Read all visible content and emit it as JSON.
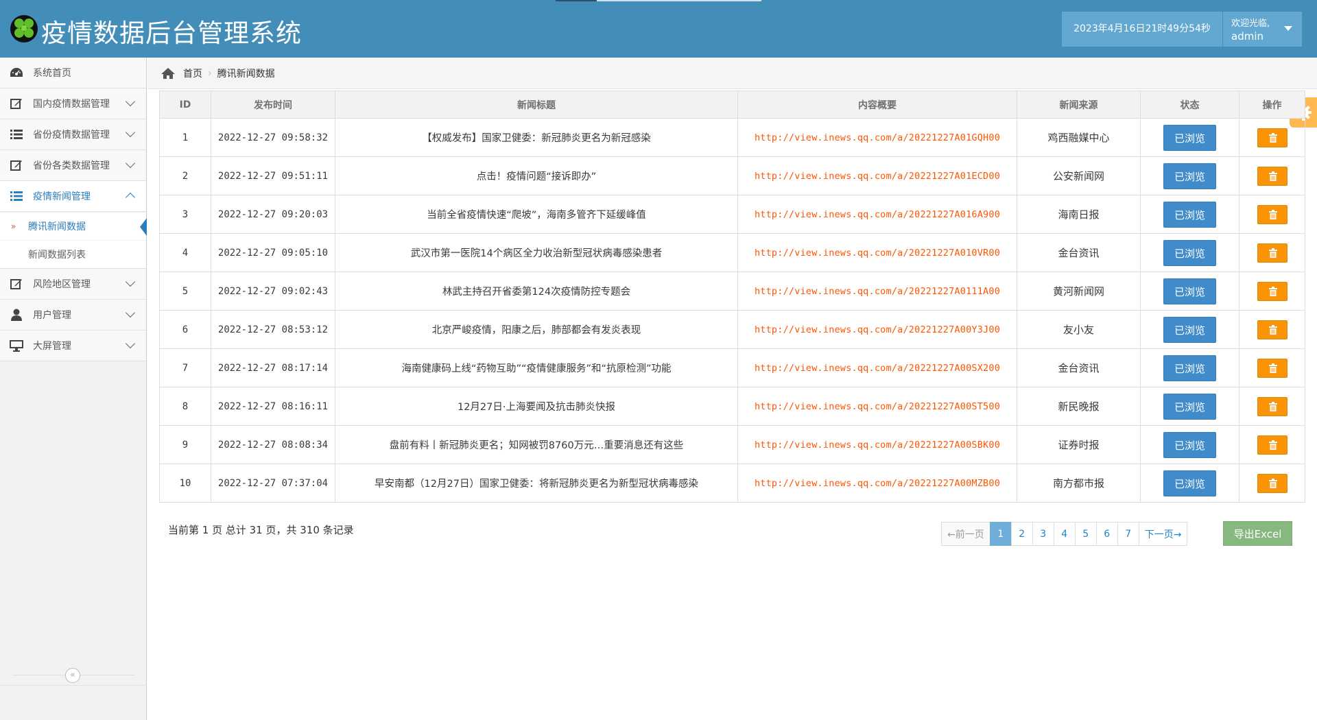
{
  "app": {
    "title": "疫情数据后台管理系统",
    "datetime": "2023年4月16日21时49分54秒",
    "welcome": "欢迎光临,",
    "username": "admin"
  },
  "sidebar": {
    "items": [
      {
        "label": "系统首页",
        "icon": "dashboard-icon"
      },
      {
        "label": "国内疫情数据管理",
        "icon": "edit-icon"
      },
      {
        "label": "省份疫情数据管理",
        "icon": "list-icon"
      },
      {
        "label": "省份各类数据管理",
        "icon": "edit-icon"
      },
      {
        "label": "疫情新闻管理",
        "icon": "list-icon"
      },
      {
        "label": "风险地区管理",
        "icon": "edit-icon"
      },
      {
        "label": "用户管理",
        "icon": "user-icon"
      },
      {
        "label": "大屏管理",
        "icon": "desktop-icon"
      }
    ],
    "submenu": [
      {
        "label": "腾讯新闻数据"
      },
      {
        "label": "新闻数据列表"
      }
    ],
    "collapse_glyph": "«"
  },
  "breadcrumb": {
    "home": "首页",
    "sep": "›",
    "current": "腾讯新闻数据"
  },
  "table": {
    "columns": [
      "ID",
      "发布时间",
      "新闻标题",
      "内容概要",
      "新闻来源",
      "状态",
      "操作"
    ],
    "rows": [
      {
        "id": "1",
        "time": "2022-12-27 09:58:32",
        "title": "【权威发布】国家卫健委：新冠肺炎更名为新冠感染",
        "url": "http://view.inews.qq.com/a/20221227A01GQH00",
        "source": "鸡西融媒中心",
        "status": "已浏览"
      },
      {
        "id": "2",
        "time": "2022-12-27 09:51:11",
        "title": "点击！疫情问题“接诉即办”",
        "url": "http://view.inews.qq.com/a/20221227A01ECD00",
        "source": "公安新闻网",
        "status": "已浏览"
      },
      {
        "id": "3",
        "time": "2022-12-27 09:20:03",
        "title": "当前全省疫情快速“爬坡”，海南多管齐下延缓峰值",
        "url": "http://view.inews.qq.com/a/20221227A016A900",
        "source": "海南日报",
        "status": "已浏览"
      },
      {
        "id": "4",
        "time": "2022-12-27 09:05:10",
        "title": "武汉市第一医院14个病区全力收治新型冠状病毒感染患者",
        "url": "http://view.inews.qq.com/a/20221227A010VR00",
        "source": "金台资讯",
        "status": "已浏览"
      },
      {
        "id": "5",
        "time": "2022-12-27 09:02:43",
        "title": "林武主持召开省委第124次疫情防控专题会",
        "url": "http://view.inews.qq.com/a/20221227A0111A00",
        "source": "黄河新闻网",
        "status": "已浏览"
      },
      {
        "id": "6",
        "time": "2022-12-27 08:53:12",
        "title": "北京严峻疫情，阳康之后，肺部都会有发炎表现",
        "url": "http://view.inews.qq.com/a/20221227A00Y3J00",
        "source": "友小友",
        "status": "已浏览"
      },
      {
        "id": "7",
        "time": "2022-12-27 08:17:14",
        "title": "海南健康码上线“药物互助”“疫情健康服务”和“抗原检测”功能",
        "url": "http://view.inews.qq.com/a/20221227A00SX200",
        "source": "金台资讯",
        "status": "已浏览"
      },
      {
        "id": "8",
        "time": "2022-12-27 08:16:11",
        "title": "12月27日·上海要闻及抗击肺炎快报",
        "url": "http://view.inews.qq.com/a/20221227A00ST500",
        "source": "新民晚报",
        "status": "已浏览"
      },
      {
        "id": "9",
        "time": "2022-12-27 08:08:34",
        "title": "盘前有料丨新冠肺炎更名；知网被罚8760万元…重要消息还有这些",
        "url": "http://view.inews.qq.com/a/20221227A00SBK00",
        "source": "证券时报",
        "status": "已浏览"
      },
      {
        "id": "10",
        "time": "2022-12-27 07:37:04",
        "title": "早安南都（12月27日）国家卫健委：将新冠肺炎更名为新型冠状病毒感染",
        "url": "http://view.inews.qq.com/a/20221227A00MZB00",
        "source": "南方都市报",
        "status": "已浏览"
      }
    ]
  },
  "footer": {
    "summary": "当前第 1 页 总计 31 页，共 310 条记录",
    "prev": "←前一页",
    "pages": [
      "1",
      "2",
      "3",
      "4",
      "5",
      "6",
      "7"
    ],
    "current_page": "1",
    "next": "下一页→",
    "export": "导出Excel"
  },
  "colors": {
    "header": "#438eb9",
    "primary_button": "#428bca",
    "delete_button": "#f89406",
    "export_button": "#87b87f",
    "link": "#ff5500"
  }
}
